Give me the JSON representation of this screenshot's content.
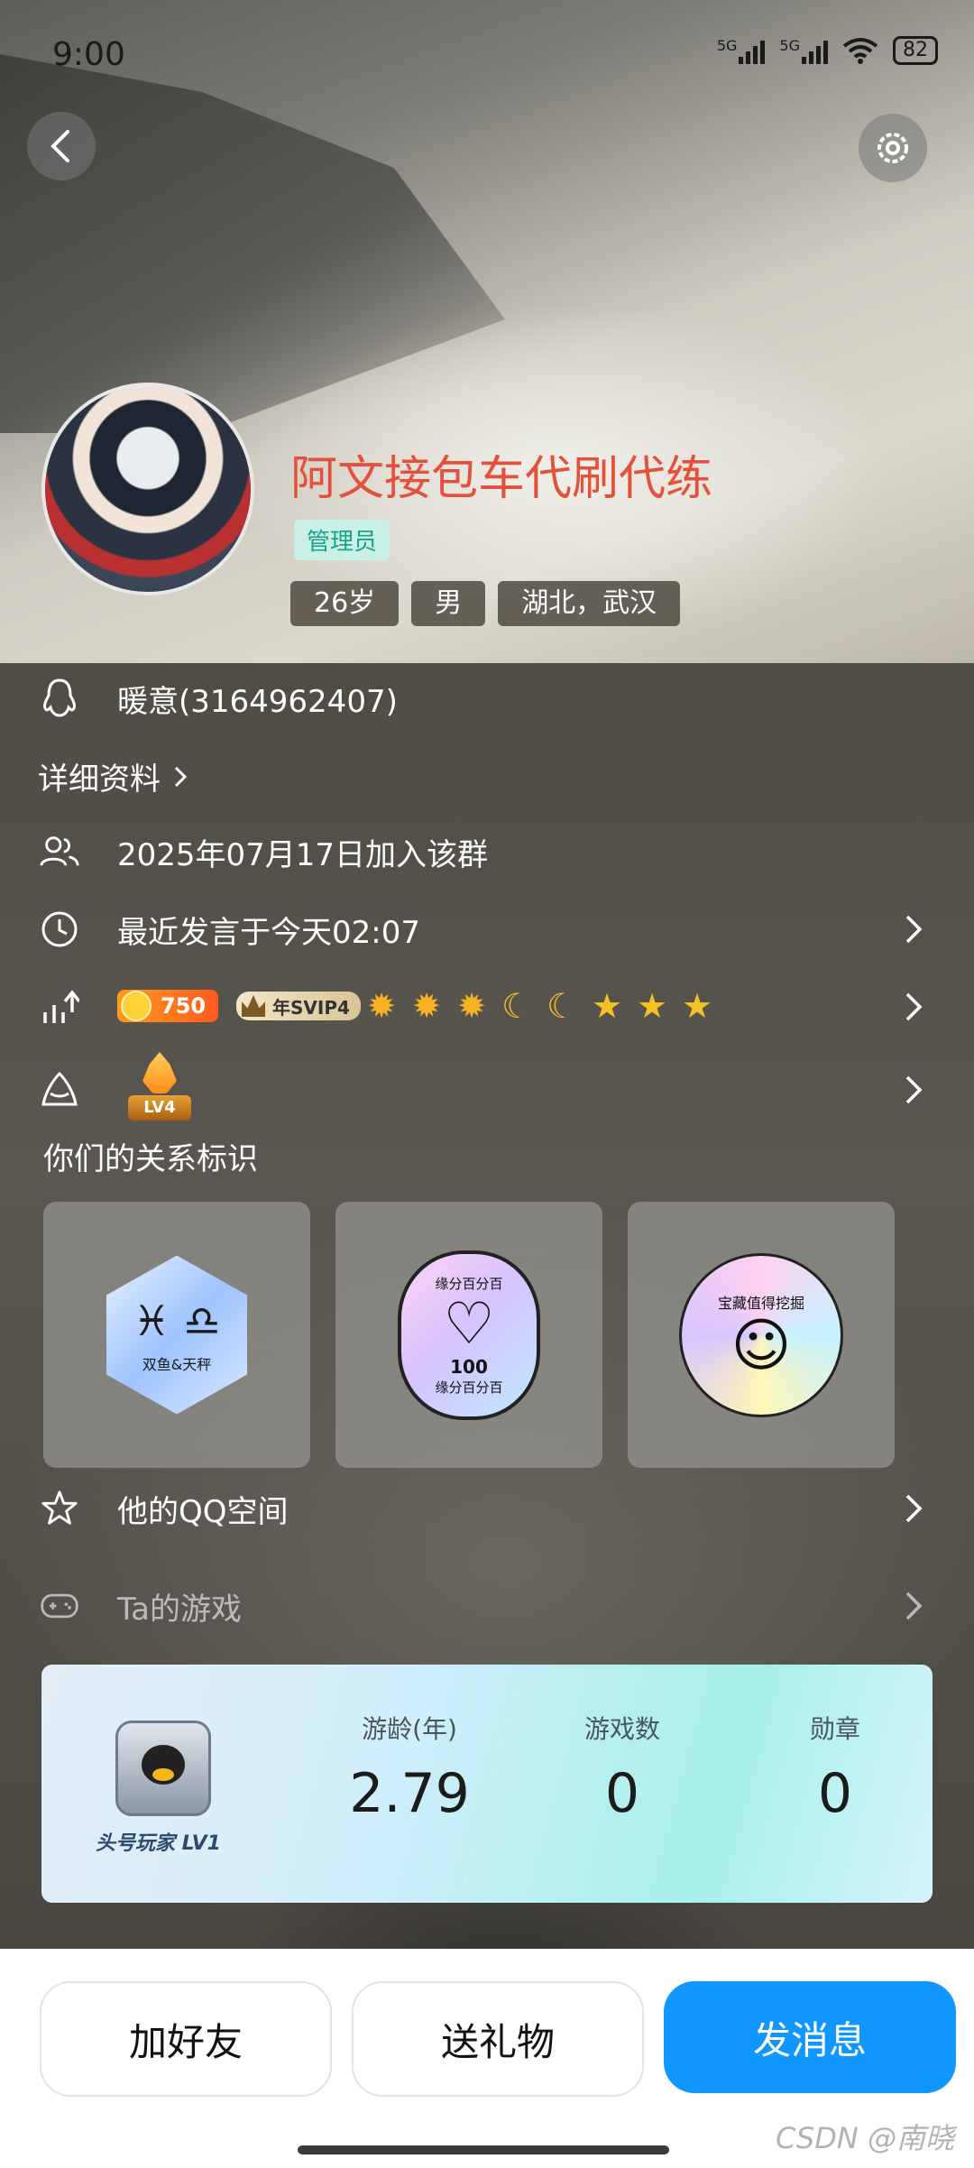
{
  "status_bar": {
    "time": "9:00",
    "network1": "5G",
    "network2": "5G",
    "battery": "82"
  },
  "profile": {
    "nickname": "阿文接包车代刷代练",
    "role_tag": "管理员",
    "pills": [
      "26岁",
      "男",
      "湖北，武汉"
    ],
    "qq_line": "暖意(3164962407)",
    "detail_link": "详细资料"
  },
  "info_rows": {
    "join": "2025年07月17日加入该群",
    "last_speak": "最近发言于今天02:07"
  },
  "badges": {
    "coin_value": "750",
    "svip_label": "年SVIP4",
    "level_icons": [
      "sun",
      "sun",
      "sun",
      "moon",
      "moon",
      "star",
      "star",
      "star"
    ],
    "group_level": "LV4"
  },
  "relationship": {
    "title": "你们的关系标识",
    "cards": [
      {
        "name": "双鱼&天秤",
        "symbols": "♓ ♎"
      },
      {
        "ring_text": "缘分百分百",
        "center": "100"
      },
      {
        "ring_text": "宝藏值得挖掘"
      }
    ]
  },
  "qzone_row": "他的QQ空间",
  "games_row": "Ta的游戏",
  "game_card": {
    "player_label": "头号玩家 LV1",
    "stats": [
      {
        "label": "游龄(年)",
        "value": "2.79"
      },
      {
        "label": "游戏数",
        "value": "0"
      },
      {
        "label": "勋章",
        "value": "0"
      }
    ]
  },
  "actions": {
    "add_friend": "加好友",
    "send_gift": "送礼物",
    "send_message": "发消息"
  },
  "watermark": "CSDN @南晓",
  "colors": {
    "primary": "#0f97ff",
    "nickname": "#e5503b",
    "admin_tag_bg": "#c9f0e6",
    "admin_tag_fg": "#1aa18a"
  }
}
